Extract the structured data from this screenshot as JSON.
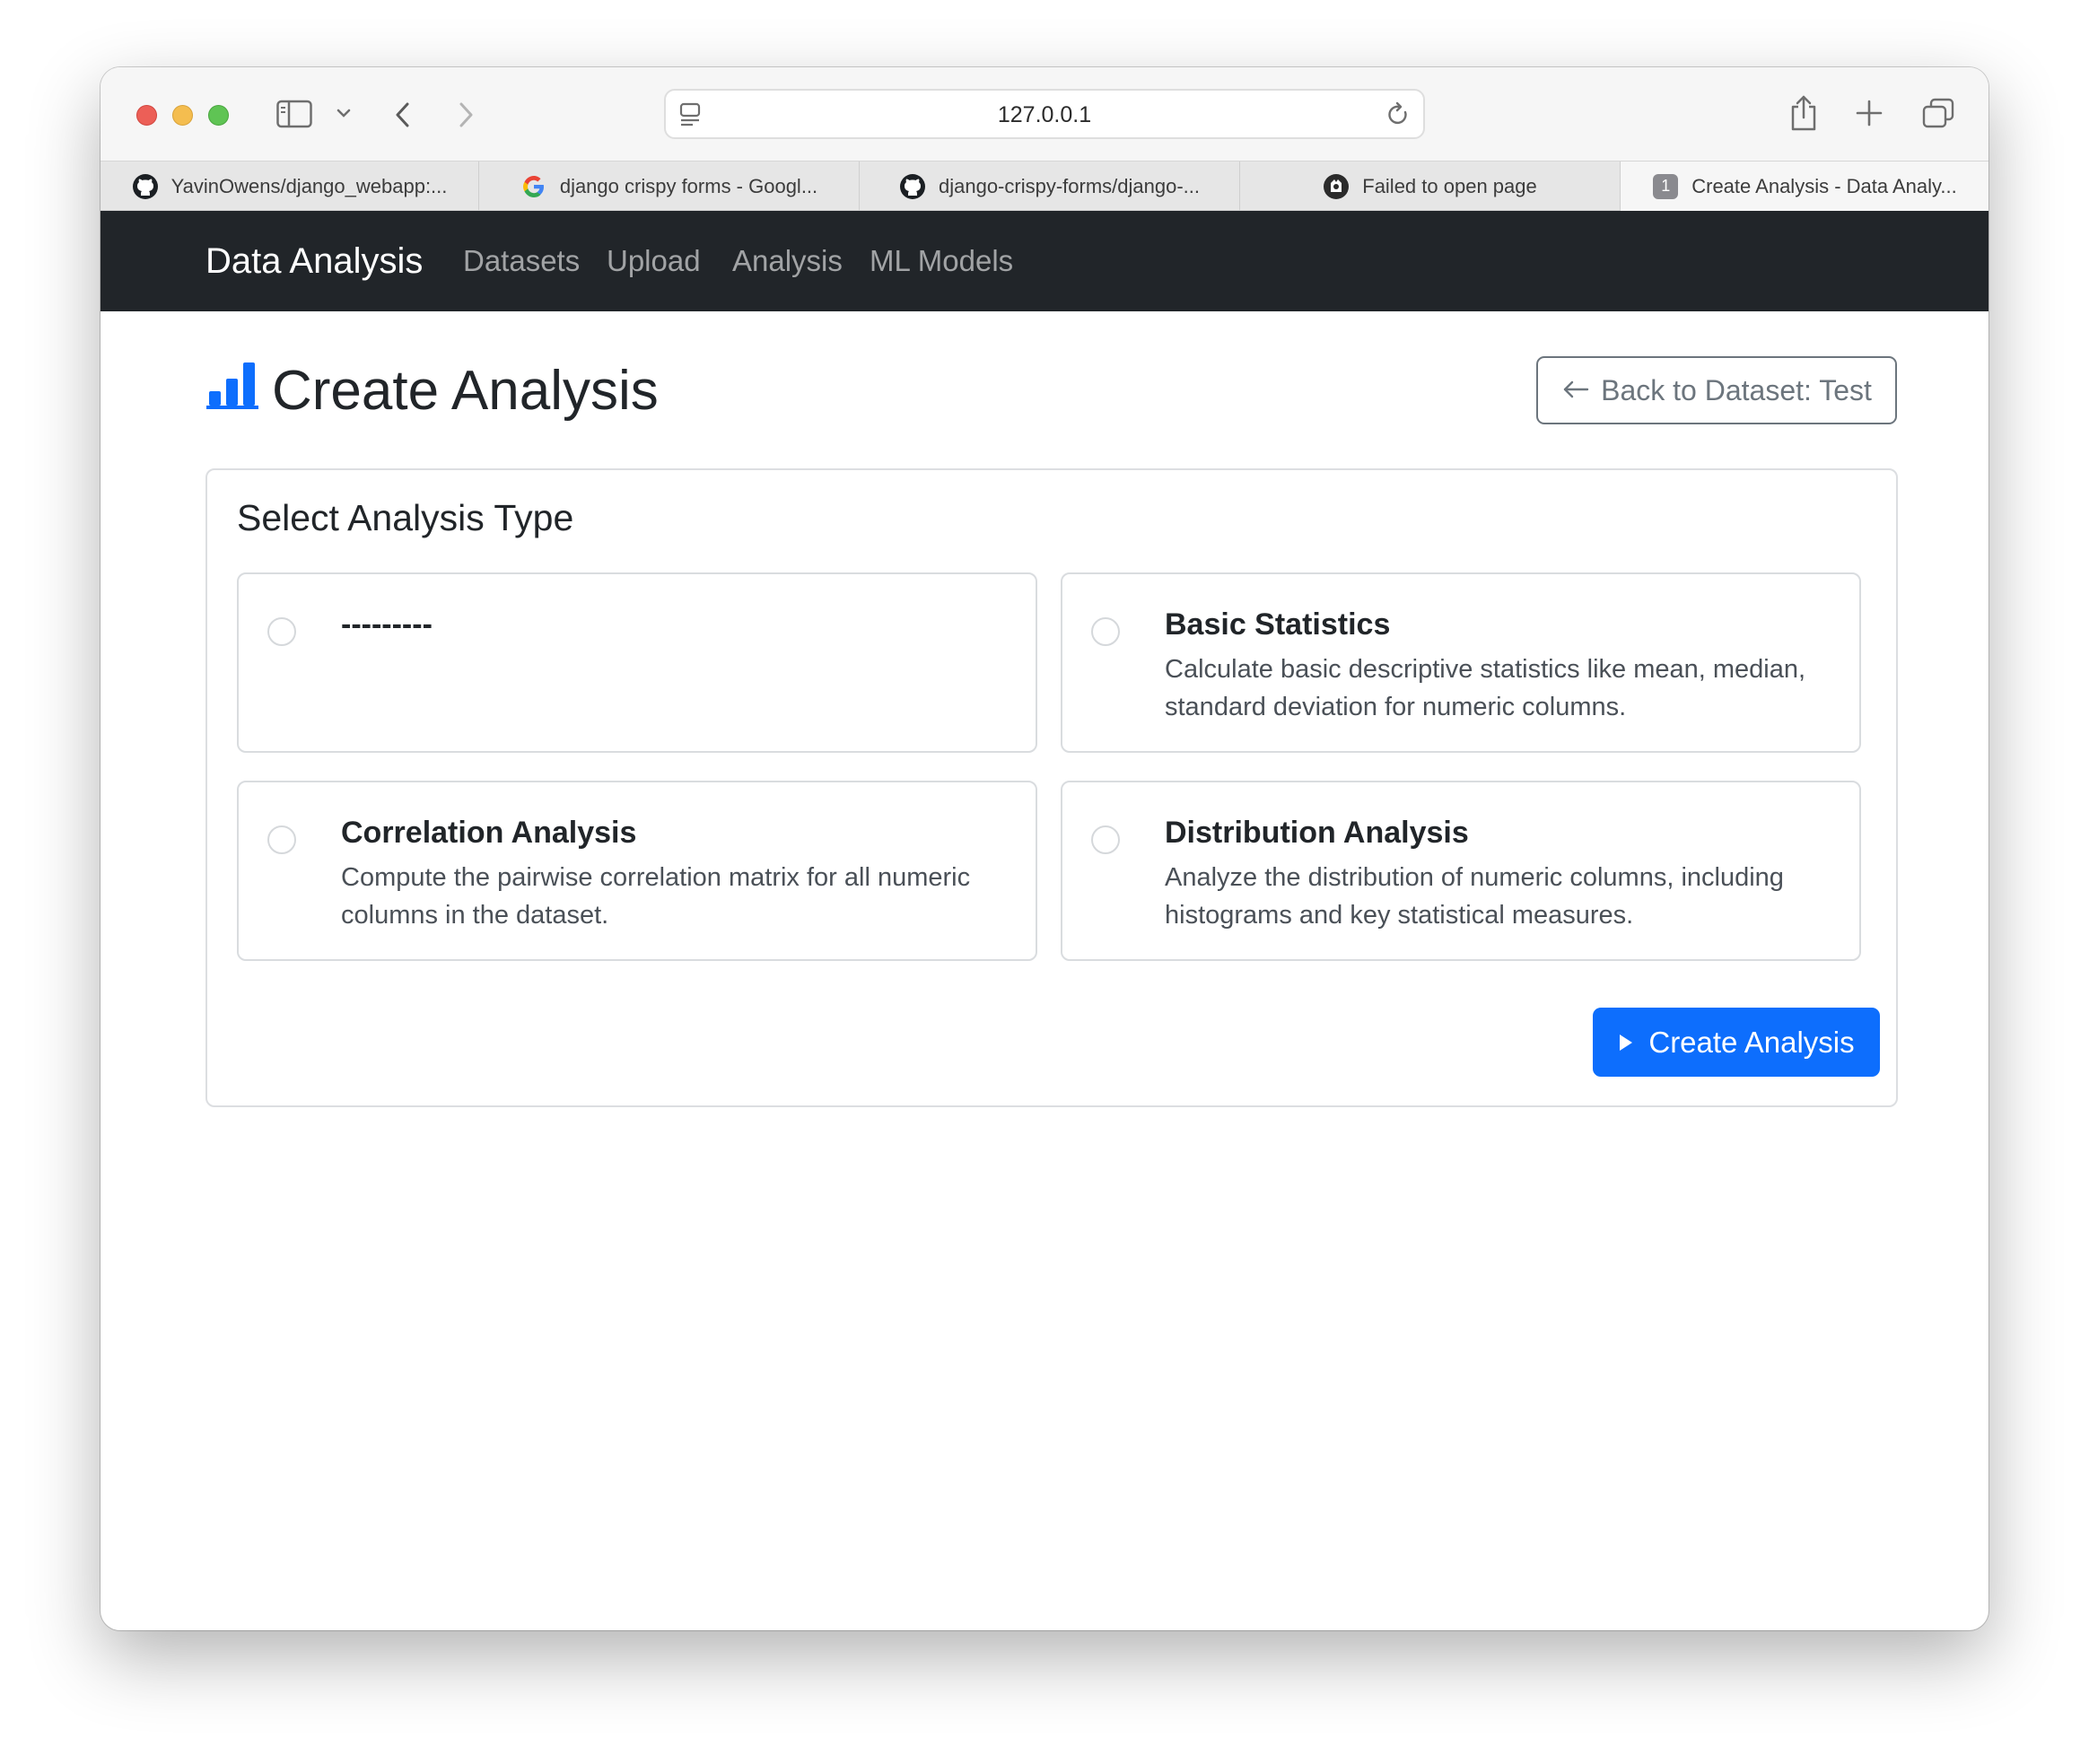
{
  "browser": {
    "url": "127.0.0.1",
    "tabs": [
      {
        "title": "YavinOwens/django_webapp:...",
        "favicon": "github-icon"
      },
      {
        "title": "django crispy forms - Googl...",
        "favicon": "google-icon"
      },
      {
        "title": "django-crispy-forms/django-...",
        "favicon": "github-icon"
      },
      {
        "title": "Failed to open page",
        "favicon": "error-icon"
      },
      {
        "title": "Create Analysis - Data Analy...",
        "favicon": "tab-number-badge",
        "badge": "1",
        "active": true
      }
    ]
  },
  "navbar": {
    "brand": "Data Analysis",
    "links": [
      "Datasets",
      "Upload",
      "Analysis",
      "ML Models"
    ]
  },
  "page": {
    "title": "Create Analysis",
    "title_icon": "bar-chart-icon",
    "back_button": "Back to Dataset: Test"
  },
  "form": {
    "heading": "Select Analysis Type",
    "options": [
      {
        "label": "---------",
        "description": "",
        "selected": false
      },
      {
        "label": "Basic Statistics",
        "description": "Calculate basic descriptive statistics like mean, median, standard deviation for numeric columns.",
        "selected": false
      },
      {
        "label": "Correlation Analysis",
        "description": "Compute the pairwise correlation matrix for all numeric columns in the dataset.",
        "selected": false
      },
      {
        "label": "Distribution Analysis",
        "description": "Analyze the distribution of numeric columns, including histograms and key statistical measures.",
        "selected": false
      }
    ],
    "submit_label": "Create Analysis"
  },
  "colors": {
    "navbar_bg": "#212529",
    "primary": "#0d6efd",
    "secondary": "#6c757d"
  }
}
